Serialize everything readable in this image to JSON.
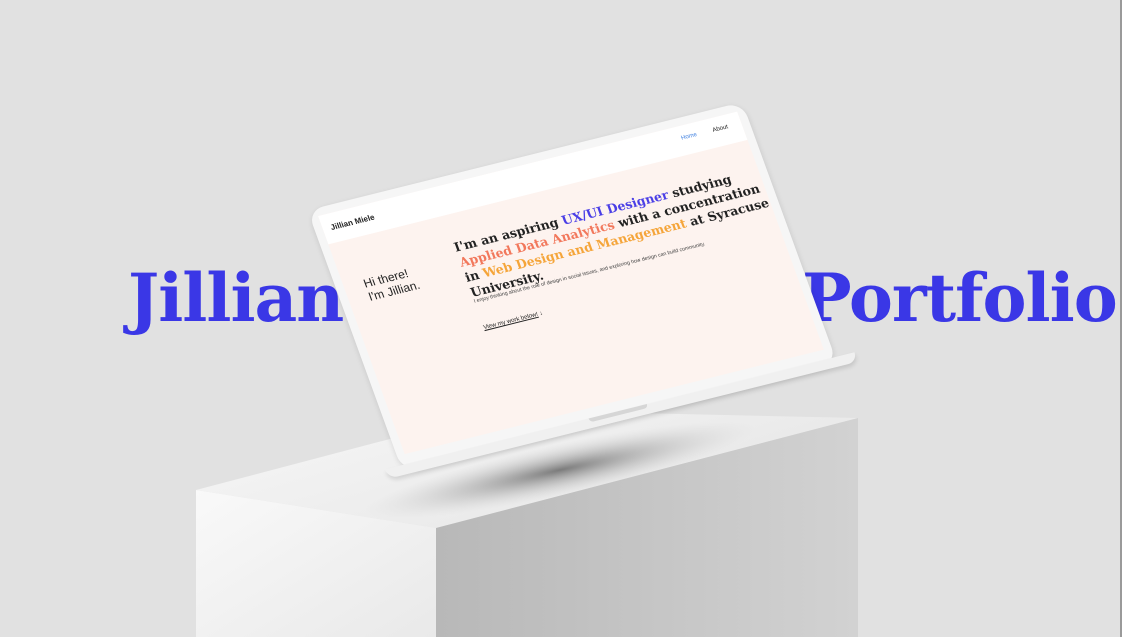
{
  "headline_left": "Jillian’s",
  "headline_right": "Portfolio",
  "site": {
    "brand": "Jillian Miele",
    "nav": {
      "home": "Home",
      "about": "About"
    },
    "greeting_line1": "Hi there!",
    "greeting_line2": "I'm Jillian.",
    "intro": {
      "p1": "I'm an aspiring ",
      "role": "UX/UI Designer",
      "p2": " studying ",
      "major": "Applied Data Analytics",
      "p3": " with a concentration in ",
      "minor": "Web Design and Management",
      "p4": " at Syracuse University."
    },
    "subtext": "I enjoy thinking about the role of design in social issues, and exploring how design can build community.",
    "cta": "View my work below!",
    "cta_arrow": "↓"
  },
  "colors": {
    "background": "#e1e1e1",
    "headline": "#3a37e6",
    "blue": "#4a3ee6",
    "coral": "#f2785c",
    "orange": "#f5a53a",
    "screen_bg": "#fdf3ef",
    "nav_link": "#3d7fe0"
  },
  "icons": {
    "arrow": "down-arrow-icon"
  }
}
